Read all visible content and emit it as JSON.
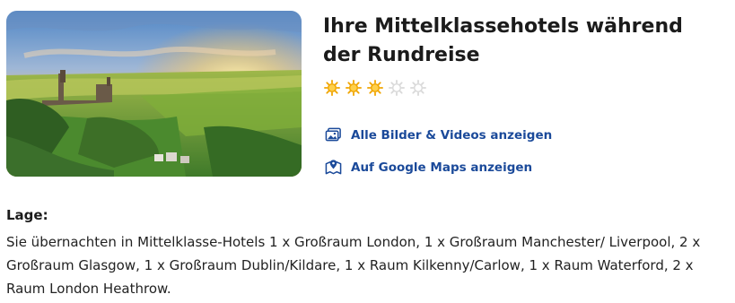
{
  "hotel": {
    "title": "Ihre Mittelklassehotels während der Rundreise",
    "star_rating": {
      "filled": 3,
      "total": 5,
      "filled_color": "#f0a500",
      "empty_color": "#d9d9d9"
    }
  },
  "links": {
    "gallery_label": "Alle Bilder & Videos anzeigen",
    "gallery_icon": "image-gallery-icon",
    "maps_label": "Auf Google Maps anzeigen",
    "maps_icon": "map-pin-icon",
    "color": "#1b4a9a"
  },
  "location": {
    "heading": "Lage:",
    "description": "Sie übernachten in Mittelklasse-Hotels 1 x Großraum London, 1 x Großraum Manchester/ Liverpool, 2 x Großraum Glasgow, 1 x Großraum Dublin/Kildare, 1 x Raum Kilkenny/Carlow, 1 x Raum Waterford, 2 x Raum London Heathrow."
  }
}
